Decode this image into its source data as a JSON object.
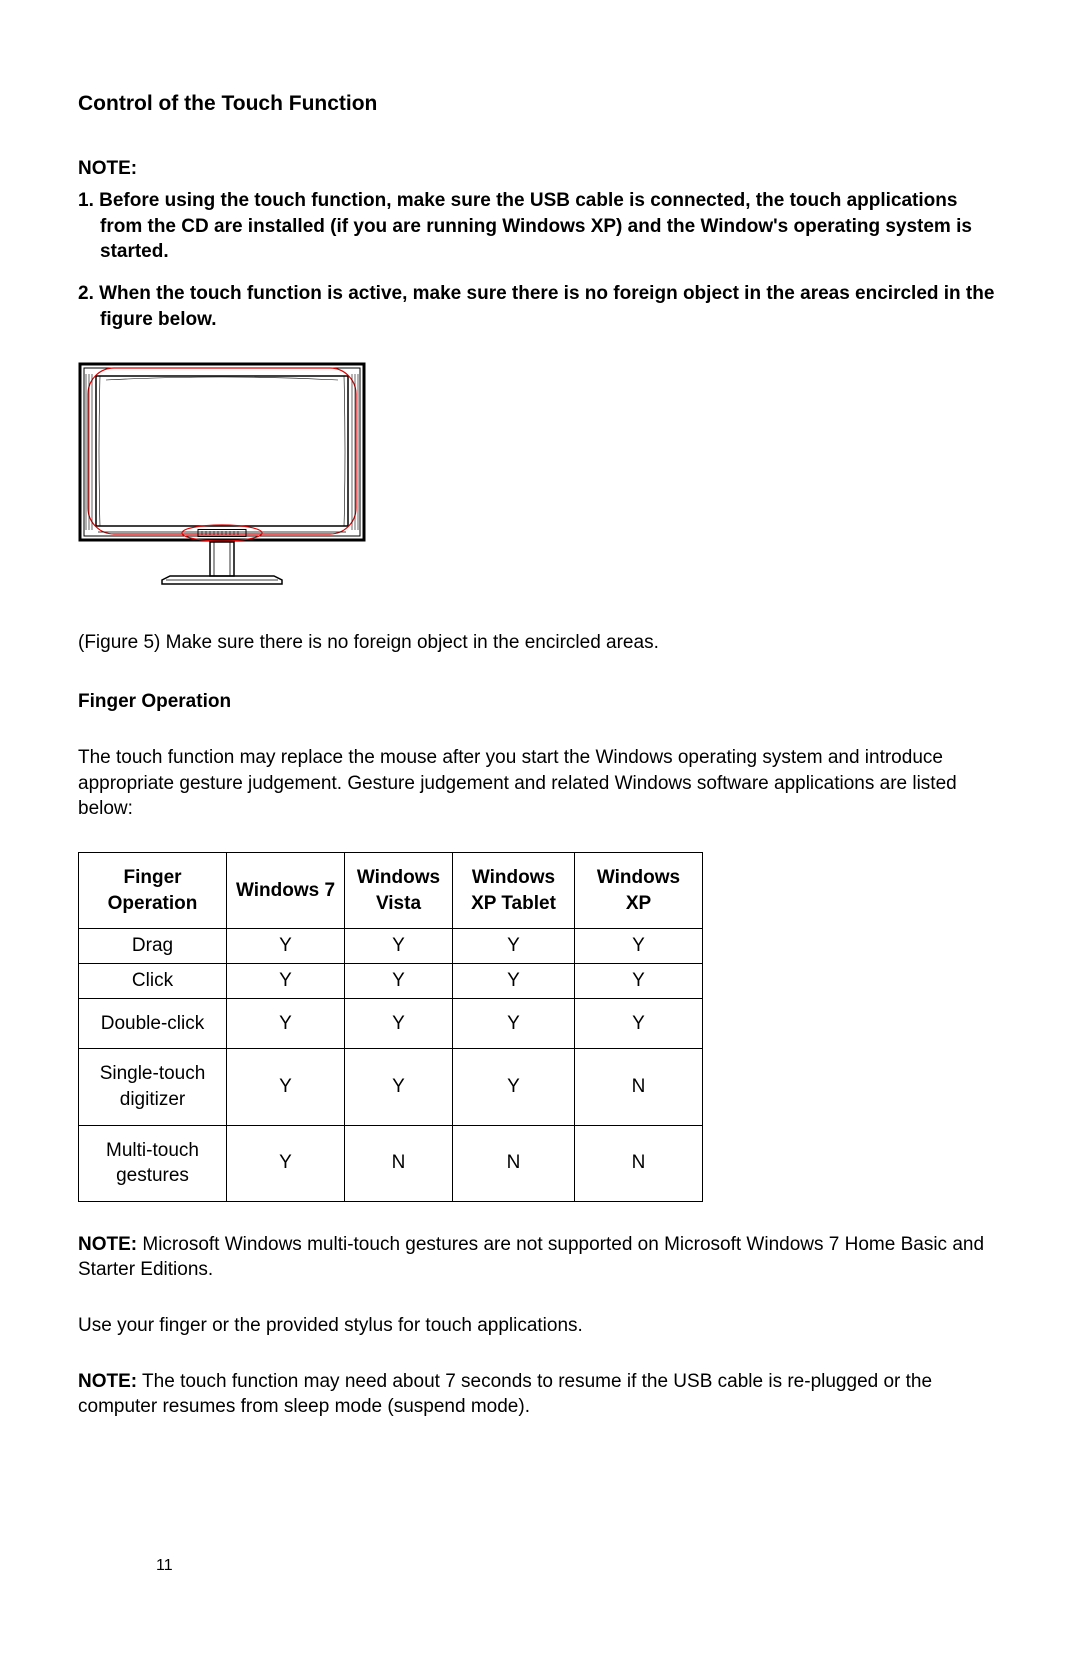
{
  "title": "Control of the Touch Function",
  "noteHeader": "NOTE:",
  "noteItem1": "1. Before using the touch function, make sure the USB cable is connected, the touch applications from the CD are installed (if you are running Windows XP) and the Window's operating system is started.",
  "noteItem2": "2. When the touch function is active, make sure there is no foreign object in the areas encircled in the figure below.",
  "figureCaption": "(Figure 5) Make sure there is no foreign object in the encircled areas.",
  "fingerOpHeading": "Finger Operation",
  "introPara": "The touch function may replace the mouse after you start the Windows operating system and introduce appropriate gesture judgement. Gesture judgement and related Windows software applications are listed below:",
  "table": {
    "headers": {
      "op": "Finger Operation",
      "w7": "Windows 7",
      "vista": "Windows Vista",
      "xpt": "Windows XP Tablet",
      "xp": "Windows XP"
    },
    "rows": [
      {
        "op": "Drag",
        "w7": "Y",
        "vista": "Y",
        "xpt": "Y",
        "xp": "Y",
        "tall": false
      },
      {
        "op": "Click",
        "w7": "Y",
        "vista": "Y",
        "xpt": "Y",
        "xp": "Y",
        "tall": false
      },
      {
        "op": "Double-click",
        "w7": "Y",
        "vista": "Y",
        "xpt": "Y",
        "xp": "Y",
        "tall": true
      },
      {
        "op": "Single-touch digitizer",
        "w7": "Y",
        "vista": "Y",
        "xpt": "Y",
        "xp": "N",
        "tall": true
      },
      {
        "op": "Multi-touch gestures",
        "w7": "Y",
        "vista": "N",
        "xpt": "N",
        "xp": "N",
        "tall": true
      }
    ]
  },
  "notePara1Label": "NOTE:",
  "notePara1Text": " Microsoft Windows multi-touch gestures are not supported on Microsoft Windows 7 Home Basic and Starter Editions.",
  "usePara": "Use your finger or the provided stylus for touch applications.",
  "notePara2Label": "NOTE:",
  "notePara2Text": " The touch function may need about 7 seconds to resume if the USB cable is re-plugged or the computer resumes from sleep mode (suspend mode).",
  "pageNumber": "11"
}
